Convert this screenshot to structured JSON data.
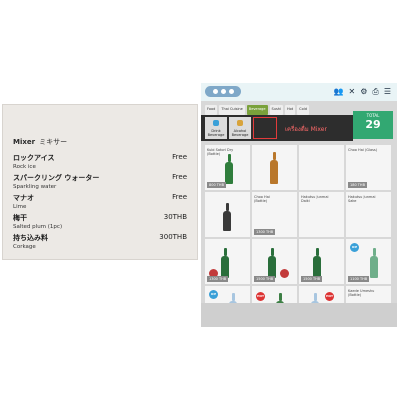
{
  "menu": {
    "header": "Mixer",
    "header_jp": "ミキサー",
    "items": [
      {
        "jp": "ロックアイス",
        "en": "Rock ice",
        "price": "Free"
      },
      {
        "jp": "スパークリング ウォーター",
        "en": "Sparkling water",
        "price": "Free"
      },
      {
        "jp": "マナオ",
        "en": "Lime",
        "price": "Free"
      },
      {
        "jp": "梅干",
        "en": "Salted plum (1pc)",
        "price": "30THB"
      },
      {
        "jp": "持ち込み料",
        "en": "Corkage",
        "price": "300THB"
      }
    ]
  },
  "tablet": {
    "tabs": [
      "Food",
      "Thai Cuisine",
      "Beverage",
      "Sushi",
      "Hot",
      "Cold"
    ],
    "active_tab": "Beverage",
    "summary_label": "TOTAL",
    "summary_value": "29",
    "subcategories": [
      {
        "label": "Drink Beverage"
      },
      {
        "label": "Alcohol Beverage"
      }
    ],
    "mixer_label": "เครื่องดื่ม Mixer",
    "products": [
      {
        "name": "Kubi Satori Dry (Bottle)",
        "price": "800 THB"
      },
      {
        "name": "",
        "price": ""
      },
      {
        "name": "",
        "price": ""
      },
      {
        "name": "Choo Hai (Glass)",
        "price": "180 THB"
      },
      {
        "name": "",
        "price": ""
      },
      {
        "name": "Choo Hai (Bottle)",
        "price": "1300 THB"
      },
      {
        "name": "Hakutsu Junmai Daiki",
        "price": ""
      },
      {
        "name": "Hakutsu Junmai Sake",
        "price": ""
      },
      {
        "name": "",
        "price": "1300 THB"
      },
      {
        "name": "",
        "price": "1500 THB"
      },
      {
        "name": "",
        "price": "1500 THB"
      },
      {
        "name": "",
        "price": "1100 THB"
      },
      {
        "name": "",
        "price": ""
      },
      {
        "name": "",
        "price": ""
      },
      {
        "name": "",
        "price": ""
      },
      {
        "name": "Kaede Umeshu (Bottle)",
        "price": ""
      }
    ]
  }
}
